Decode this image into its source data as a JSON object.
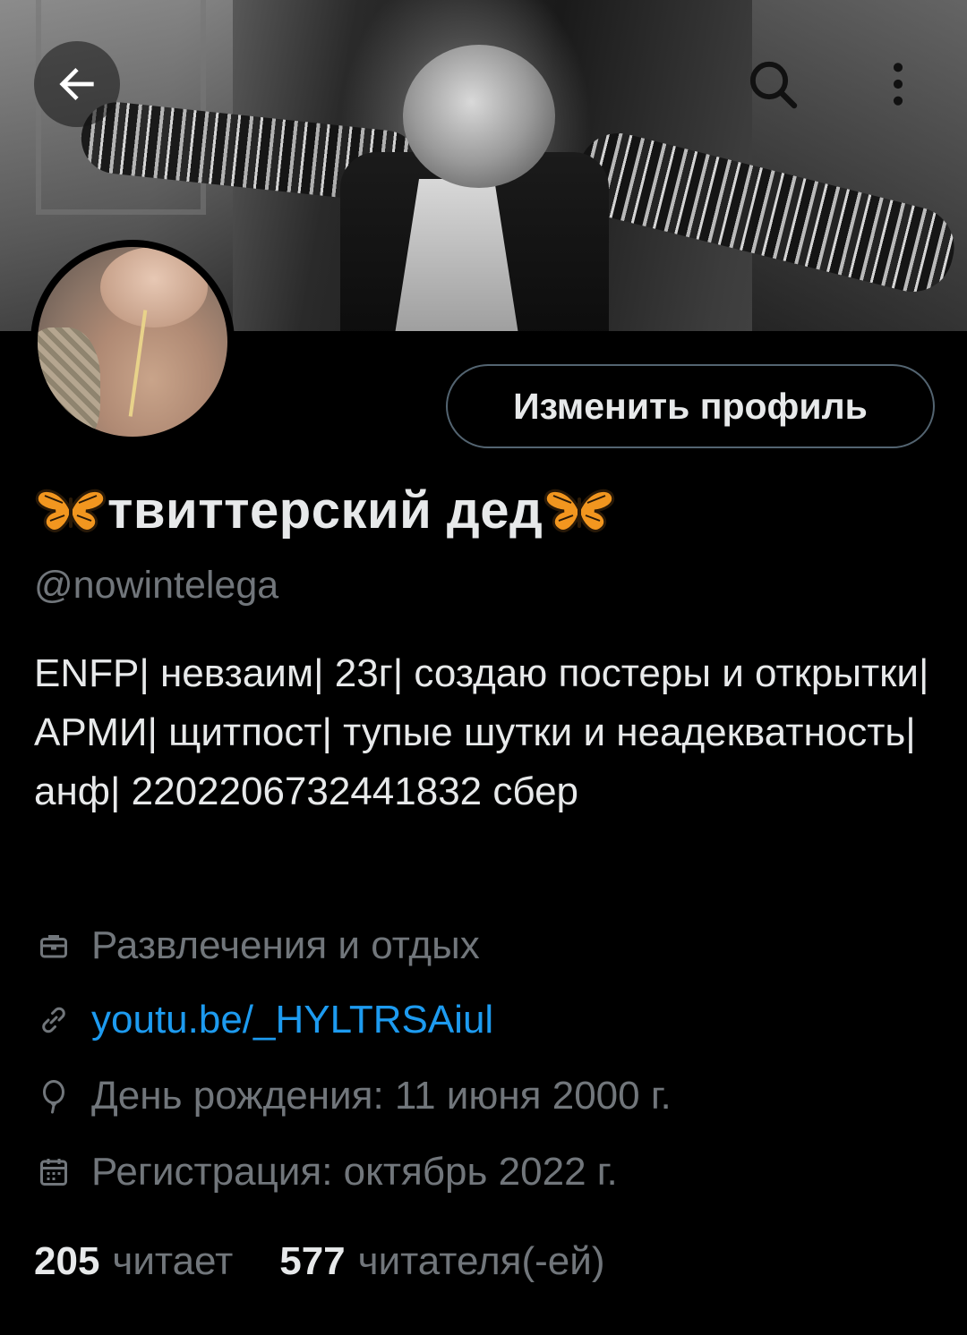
{
  "header": {
    "back_icon": "arrow-left-icon",
    "search_icon": "search-icon",
    "more_icon": "more-vertical-icon"
  },
  "profile": {
    "edit_button_label": "Изменить профиль",
    "display_name": "твиттерский дед",
    "display_name_emoji": "butterfly-icon",
    "handle": "@nowintelega",
    "bio": "ENFP| невзаим| 23г| создаю постеры и открытки| АРМИ| щитпост| тупые шутки и неадекватность| анф| 2202206732441832 сбер"
  },
  "meta": {
    "category": "Развлечения и отдых",
    "link": "youtu.be/_HYLTRSAiul",
    "birthday": "День рождения: 11 июня 2000 г.",
    "joined": "Регистрация: октябрь 2022 г."
  },
  "stats": {
    "following_count": "205",
    "following_label": "читает",
    "followers_count": "577",
    "followers_label": "читателя(-ей)"
  },
  "colors": {
    "background": "#000000",
    "text_primary": "#e7e9ea",
    "text_secondary": "#71767b",
    "link": "#1d9bf0",
    "border": "#536471"
  }
}
